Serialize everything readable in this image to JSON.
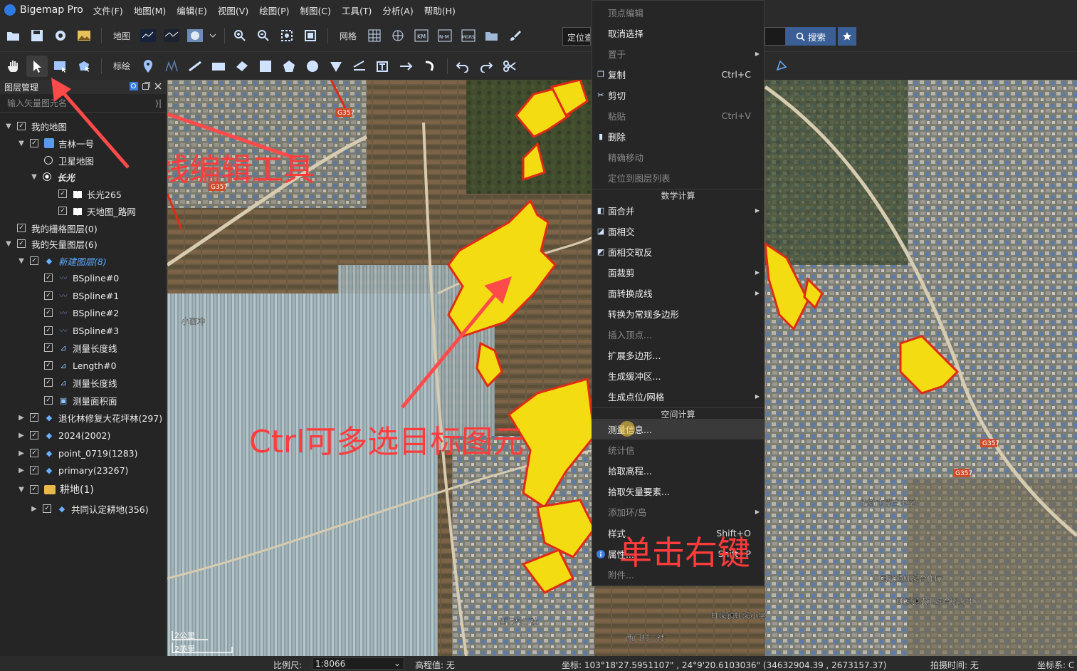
{
  "app": {
    "title": "Bigemap Pro",
    "menus": [
      "文件(F)",
      "地图(M)",
      "编辑(E)",
      "视图(V)",
      "绘图(P)",
      "制图(C)",
      "工具(T)",
      "分析(A)",
      "帮助(H)"
    ]
  },
  "toolbar1": {
    "map_label": "地图",
    "grid_label": "网格",
    "locate_placeholder": "定位查",
    "search_label": "搜索"
  },
  "toolbar2": {
    "draw_label": "标绘"
  },
  "layer_panel": {
    "title": "图层管理",
    "search_placeholder": "输入矢量图元名",
    "items": [
      {
        "label": "我的地图"
      },
      {
        "label": "吉林一号"
      },
      {
        "label": "卫星地图"
      },
      {
        "label": "长光"
      },
      {
        "label": "长光265"
      },
      {
        "label": "天地图_路网"
      },
      {
        "label": "我的栅格图层(0)"
      },
      {
        "label": "我的矢量图层(6)"
      },
      {
        "label": "新建图层(8)"
      },
      {
        "label": "BSpline#0"
      },
      {
        "label": "BSpline#1"
      },
      {
        "label": "BSpline#2"
      },
      {
        "label": "BSpline#3"
      },
      {
        "label": "测量长度线"
      },
      {
        "label": "Length#0"
      },
      {
        "label": "测量长度线"
      },
      {
        "label": "测量面积面"
      },
      {
        "label": "退化林修复大花坪林(297)"
      },
      {
        "label": "2024(2002)"
      },
      {
        "label": "point_0719(1283)"
      },
      {
        "label": "primary(23267)"
      },
      {
        "label": "耕地(1)"
      },
      {
        "label": "共同认定耕地(356)"
      }
    ]
  },
  "context_menu": {
    "items": [
      {
        "label": "顶点编辑",
        "disabled": true
      },
      {
        "label": "取消选择"
      },
      {
        "label": "置于",
        "submenu": true
      },
      {
        "label": "复制",
        "shortcut": "Ctrl+C"
      },
      {
        "label": "剪切"
      },
      {
        "label": "粘贴",
        "shortcut": "Ctrl+V",
        "disabled": true
      },
      {
        "label": "删除"
      },
      {
        "label": "精确移动",
        "disabled": true
      },
      {
        "label": "定位到图层列表",
        "disabled": true
      },
      {
        "label": "数学计算",
        "section": true
      },
      {
        "label": "面合并",
        "submenu": true
      },
      {
        "label": "面相交"
      },
      {
        "label": "面相交取反"
      },
      {
        "label": "面裁剪",
        "submenu": true
      },
      {
        "label": "面转换成线",
        "submenu": true
      },
      {
        "label": "转换为常规多边形"
      },
      {
        "label": "插入顶点...",
        "disabled": true
      },
      {
        "label": "扩展多边形..."
      },
      {
        "label": "生成缓冲区..."
      },
      {
        "label": "生成点位/网格",
        "submenu": true
      },
      {
        "label": "空间计算",
        "section": true
      },
      {
        "label": "测量信息..."
      },
      {
        "label": "统计信",
        "disabled": true
      },
      {
        "label": "拾取高程..."
      },
      {
        "label": "拾取矢量要素..."
      },
      {
        "label": "添加环/岛",
        "submenu": true,
        "disabled": true
      },
      {
        "label": "样式",
        "shortcut": "Shift+O"
      },
      {
        "label": "属性...",
        "shortcut": "Shift+P"
      },
      {
        "label": "附件...",
        "disabled": true
      }
    ]
  },
  "map": {
    "labels": [
      "G357",
      "G357",
      "小西冲",
      "西门村二社",
      "西门村三社",
      "弥勒市第三中学",
      "中国联通虹溪合作厅",
      "虹溪镇农业综合服务中心",
      "虹溪镇虹溪小学",
      "G357",
      "G357"
    ],
    "scale_labels": [
      "2公里",
      "2英里"
    ]
  },
  "annotations": {
    "online_edit": "在线编辑工具",
    "multi_select": "Ctrl可多选目标图元",
    "right_click": "单击右键"
  },
  "status": {
    "scale_label": "比例尺:",
    "scale_value": "1:8066",
    "elevation": "高程值: 无",
    "coords": "坐标: 103°18'27.5951107\" , 24°9'20.6103036\"  (34632904.39 , 2673157.37)",
    "capture_time": "拍摄时间: 无",
    "crs": "坐标系: C"
  }
}
